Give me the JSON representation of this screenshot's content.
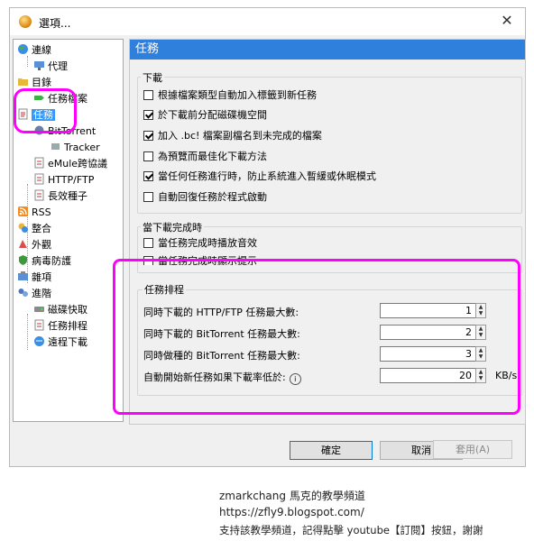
{
  "window": {
    "title": "選項...",
    "close_glyph": "✕"
  },
  "tree": {
    "items": [
      {
        "label": "連線",
        "icon": "globe-icon"
      },
      {
        "label": "代理",
        "icon": "network-icon"
      },
      {
        "label": "目錄",
        "icon": "folder-icon"
      },
      {
        "label": "任務檔案",
        "icon": "tag-icon"
      },
      {
        "label": "任務",
        "icon": "task-icon"
      },
      {
        "label": "BitTorrent",
        "icon": "bittorrent-icon"
      },
      {
        "label": "Tracker",
        "icon": "tracker-icon"
      },
      {
        "label": "eMule跨協議",
        "icon": "emule-icon"
      },
      {
        "label": "HTTP/FTP",
        "icon": "http-icon"
      },
      {
        "label": "長效種子",
        "icon": "seed-icon"
      },
      {
        "label": "RSS",
        "icon": "rss-icon"
      },
      {
        "label": "整合",
        "icon": "integration-icon"
      },
      {
        "label": "外觀",
        "icon": "appearance-icon"
      },
      {
        "label": "病毒防護",
        "icon": "shield-icon"
      },
      {
        "label": "雜項",
        "icon": "misc-icon"
      },
      {
        "label": "進階",
        "icon": "advanced-icon"
      },
      {
        "label": "磁碟快取",
        "icon": "disk-icon"
      },
      {
        "label": "任務排程",
        "icon": "schedule-icon"
      },
      {
        "label": "遠程下載",
        "icon": "remote-icon"
      }
    ]
  },
  "panel": {
    "title": "任務",
    "download_group": {
      "label": "下載",
      "options": [
        {
          "label": "根據檔案類型自動加入標籤到新任務",
          "checked": false
        },
        {
          "label": "於下載前分配磁碟機空間",
          "checked": true
        },
        {
          "label": "加入 .bc! 檔案副檔名到未完成的檔案",
          "checked": true
        },
        {
          "label": "為預覽而最佳化下載方法",
          "checked": false
        },
        {
          "label": "當任何任務進行時，防止系統進入暫緩或休眠模式",
          "checked": true
        },
        {
          "label": "自動回復任務於程式啟動",
          "checked": false
        }
      ]
    },
    "complete_group": {
      "label": "當下載完成時",
      "options": [
        {
          "label": "當任務完成時播放音效",
          "checked": false
        },
        {
          "label": "當任務完成時顯示提示",
          "checked": false
        }
      ]
    },
    "schedule_group": {
      "label": "任務排程",
      "rows": [
        {
          "label": "同時下載的 HTTP/FTP 任務最大數:",
          "value": "1",
          "unit": ""
        },
        {
          "label": "同時下載的 BitTorrent 任務最大數:",
          "value": "2",
          "unit": ""
        },
        {
          "label": "同時做種的 BitTorrent 任務最大數:",
          "value": "3",
          "unit": ""
        },
        {
          "label": "自動開始新任務如果下載率低於:",
          "value": "20",
          "unit": "KB/s"
        }
      ],
      "info_glyph": "i"
    }
  },
  "buttons": {
    "ok": "確定",
    "cancel": "取消",
    "apply": "套用(A)"
  },
  "spin": {
    "up": "▲",
    "down": "▼"
  },
  "footer": {
    "line1": "zmarkchang 馬克的教學頻道",
    "line2": "https://zfly9.blogspot.com/",
    "line3": "支持該教學頻道，記得點擊 youtube【訂閱】按鈕，謝謝"
  },
  "colors": {
    "accent": "#2f7fdd",
    "selection": "#3399ff",
    "highlight": "#ff00ff"
  }
}
